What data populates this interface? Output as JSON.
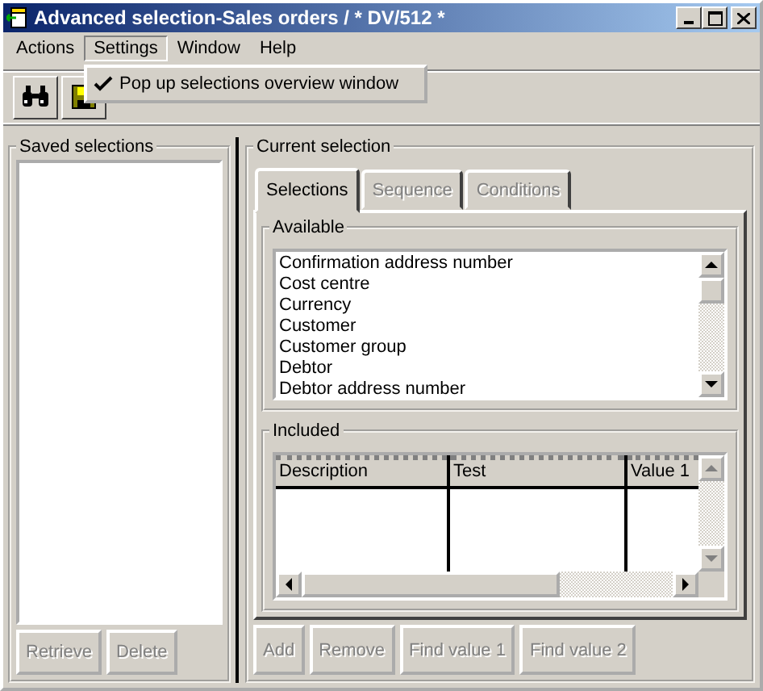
{
  "window": {
    "title": "Advanced selection-Sales orders / * DV/512 *"
  },
  "menus": [
    {
      "label": "Actions",
      "selected": false
    },
    {
      "label": "Settings",
      "selected": true
    },
    {
      "label": "Window",
      "selected": false
    },
    {
      "label": "Help",
      "selected": false
    }
  ],
  "open_menu": {
    "items": [
      {
        "label": "Pop up selections overview window",
        "checked": true
      }
    ]
  },
  "saved_selections": {
    "title": "Saved selections",
    "buttons": [
      {
        "label": "Retrieve",
        "disabled": true
      },
      {
        "label": "Delete",
        "disabled": true
      }
    ]
  },
  "current_selection": {
    "title": "Current selection",
    "tabs": [
      {
        "label": "Selections",
        "selected": true,
        "disabled": false
      },
      {
        "label": "Sequence",
        "selected": false,
        "disabled": true
      },
      {
        "label": "Conditions",
        "selected": false,
        "disabled": true
      }
    ],
    "available": {
      "title": "Available",
      "items": [
        "Confirmation address number",
        "Cost centre",
        "Currency",
        "Customer",
        "Customer group",
        "Debtor",
        "Debtor address number"
      ]
    },
    "included": {
      "title": "Included",
      "columns": [
        "Description",
        "Test",
        "Value 1"
      ]
    },
    "buttons": [
      {
        "label": "Add",
        "disabled": true
      },
      {
        "label": "Remove",
        "disabled": true
      },
      {
        "label": "Find value 1",
        "disabled": true
      },
      {
        "label": "Find value 2",
        "disabled": true
      }
    ]
  }
}
